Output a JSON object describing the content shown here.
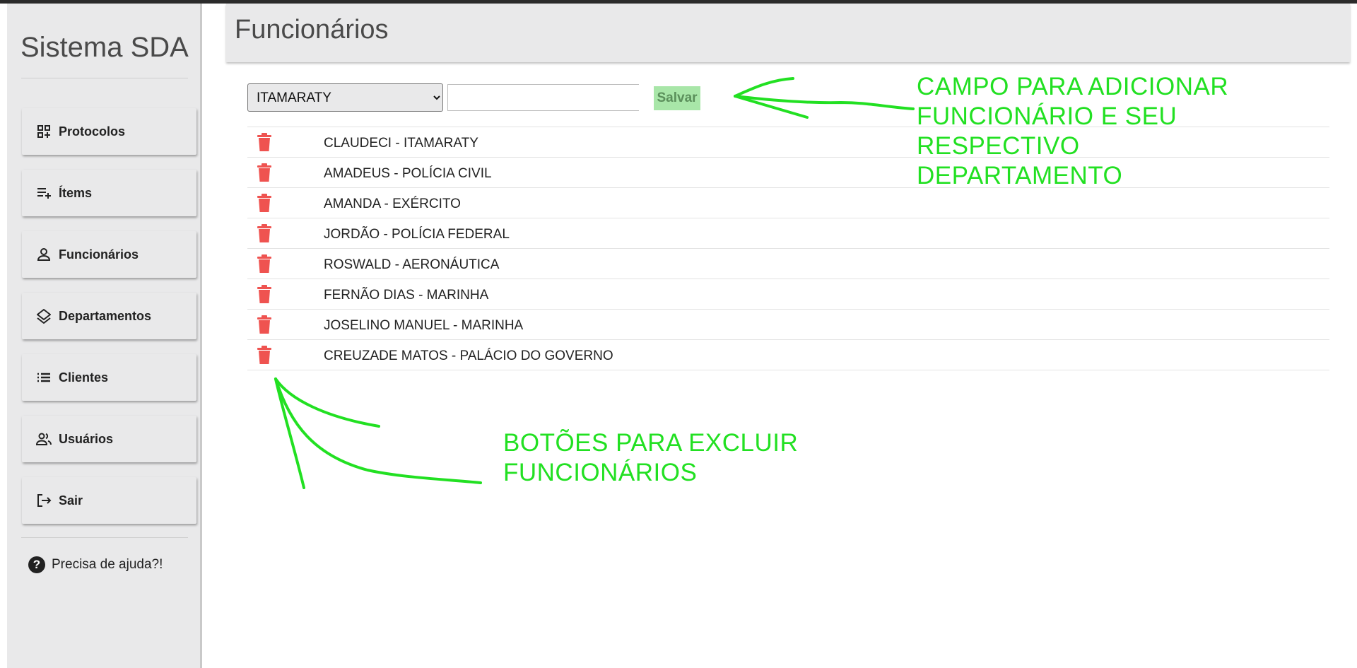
{
  "app": {
    "title": "Sistema SDA"
  },
  "sidebar": {
    "items": [
      {
        "label": "Protocolos",
        "icon": "add-widget-icon"
      },
      {
        "label": "Ítems",
        "icon": "playlist-add-icon"
      },
      {
        "label": "Funcionários",
        "icon": "person-icon"
      },
      {
        "label": "Departamentos",
        "icon": "layers-icon"
      },
      {
        "label": "Clientes",
        "icon": "list-icon"
      },
      {
        "label": "Usuários",
        "icon": "people-icon"
      },
      {
        "label": "Sair",
        "icon": "logout-icon"
      }
    ],
    "help_label": "Precisa de ajuda?!"
  },
  "header": {
    "title": "Funcionários"
  },
  "form": {
    "department_selected": "ITAMARATY",
    "name_value": "",
    "save_label": "Salvar"
  },
  "employees": [
    "CLAUDECI - ITAMARATY",
    "AMADEUS - POLÍCIA CIVIL",
    "AMANDA - EXÉRCITO",
    "JORDÃO - POLÍCIA FEDERAL",
    "ROSWALD - AERONÁUTICA",
    "FERNÃO DIAS - MARINHA",
    "JOSELINO MANUEL - MARINHA",
    "CREUZADE MATOS - PALÁCIO DO GOVERNO"
  ],
  "annotations": {
    "add_field": [
      "CAMPO PARA ADICIONAR",
      "FUNCIONÁRIO E SEU",
      "RESPECTIVO",
      "DEPARTAMENTO"
    ],
    "delete_buttons": [
      "BOTÕES PARA EXCLUIR",
      "FUNCIONÁRIOS"
    ]
  },
  "colors": {
    "delete_icon": "#ef5350",
    "annotation": "#22e022",
    "save_bg": "#a8e6a8"
  }
}
